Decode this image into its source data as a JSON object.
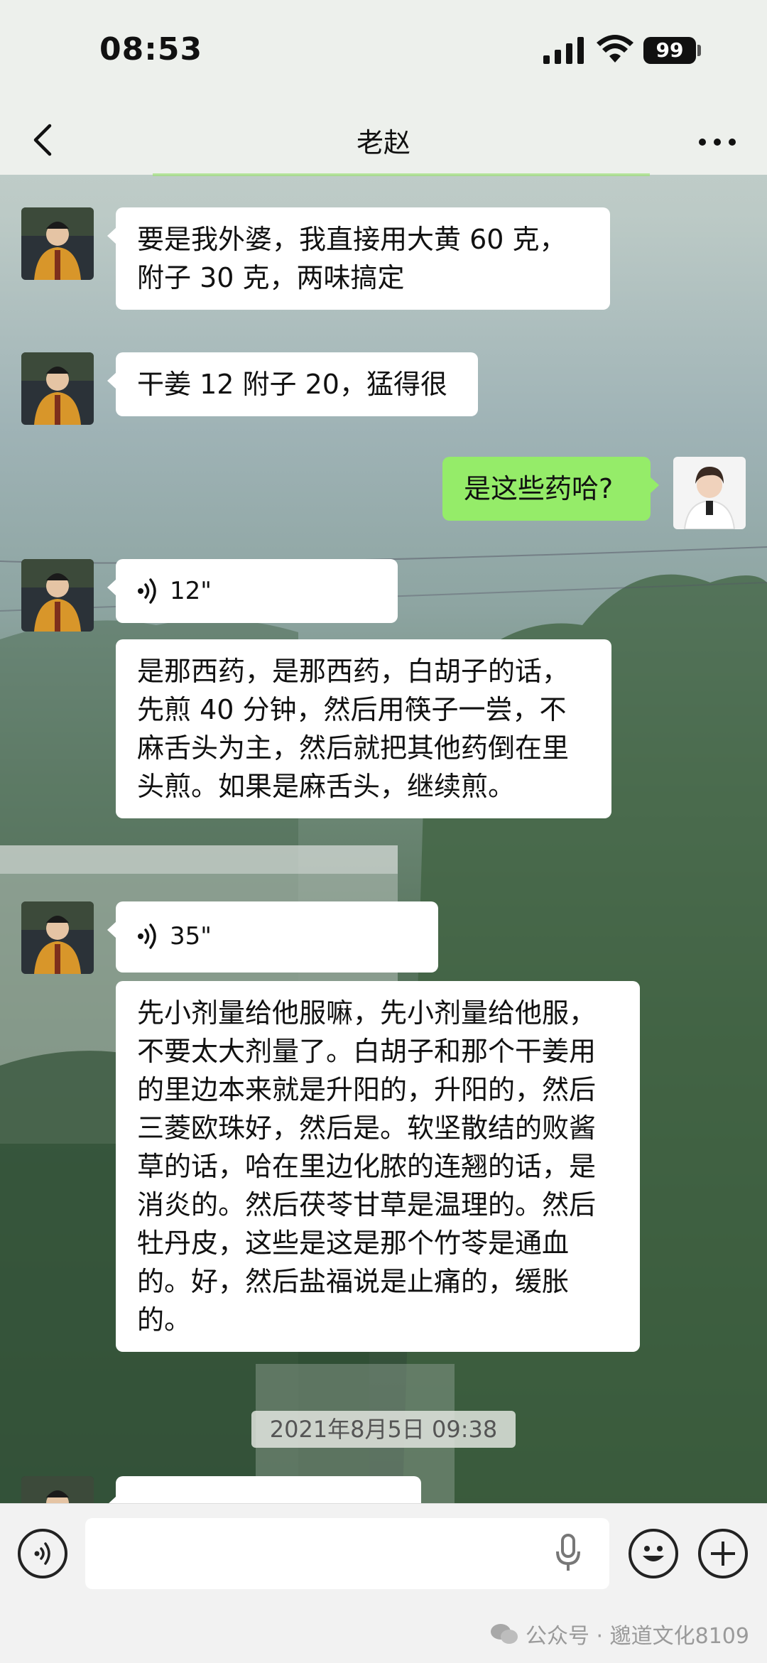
{
  "status_bar": {
    "time": "08:53",
    "battery": "99"
  },
  "header": {
    "title": "老赵"
  },
  "messages": [
    {
      "text": "要是我外婆，我直接用大黄 60 克，附子 30 克，两味搞定"
    },
    {
      "text": "干姜 12 附子 20，猛得很"
    },
    {
      "text": "是这些药哈?"
    },
    {
      "duration": "12\""
    },
    {
      "text": "是那西药，是那西药，白胡子的话，先煎 40 分钟，然后用筷子一尝，不麻舌头为主，然后就把其他药倒在里头煎。如果是麻舌头，继续煎。"
    },
    {
      "duration": "35\""
    },
    {
      "text": "先小剂量给他服嘛，先小剂量给他服，不要太大剂量了。白胡子和那个干姜用的里边本来就是升阳的，升阳的，然后三菱欧珠好，然后是。软坚散结的败酱草的话，哈在里边化脓的连翘的话，是消炎的。然后茯苓甘草是温理的。然后牡丹皮，这些是这是那个竹苓是通血的。好，然后盐福说是止痛的，缓胀的。"
    }
  ],
  "timestamp": "2021年8月5日 09:38",
  "watermark": "公众号 · 邈道文化8109",
  "colors": {
    "sent_bubble": "#95ec69",
    "received_bubble": "#ffffff"
  }
}
